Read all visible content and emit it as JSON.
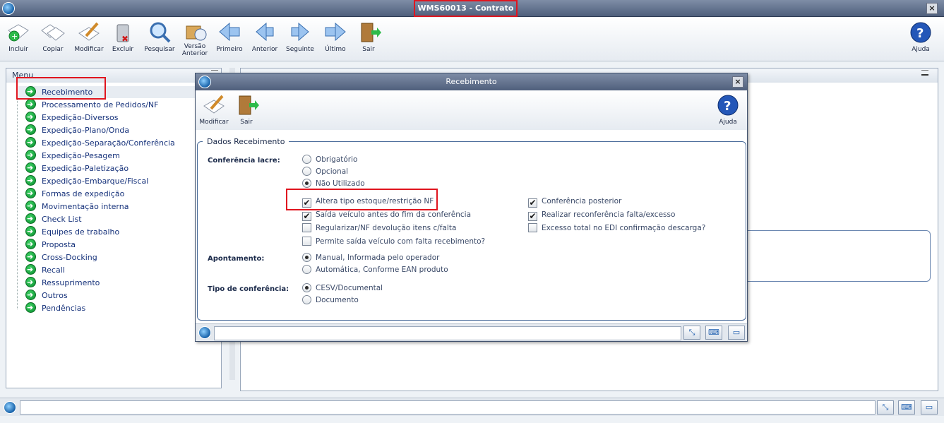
{
  "window": {
    "title": "WMS60013 - Contrato"
  },
  "toolbar": {
    "buttons": [
      {
        "label": "Incluir",
        "icon": "add-doc-icon"
      },
      {
        "label": "Copiar",
        "icon": "copy-icon"
      },
      {
        "label": "Modificar",
        "icon": "edit-icon"
      },
      {
        "label": "Excluir",
        "icon": "trash-icon"
      },
      {
        "label": "Pesquisar",
        "icon": "search-icon"
      },
      {
        "label": "Versão Anterior",
        "icon": "version-icon"
      },
      {
        "label": "Primeiro",
        "icon": "first-icon"
      },
      {
        "label": "Anterior",
        "icon": "prev-icon"
      },
      {
        "label": "Seguinte",
        "icon": "next-icon"
      },
      {
        "label": "Último",
        "icon": "last-icon"
      },
      {
        "label": "Sair",
        "icon": "exit-icon"
      }
    ],
    "help_label": "Ajuda"
  },
  "menu": {
    "title": "Menu",
    "items": [
      "Recebimento",
      "Processamento de Pedidos/NF",
      "Expedição-Diversos",
      "Expedição-Plano/Onda",
      "Expedição-Separação/Conferência",
      "Expedição-Pesagem",
      "Expedição-Paletização",
      "Expedição-Embarque/Fiscal",
      "Formas de expedição",
      "Movimentação interna",
      "Check List",
      "Equipes de trabalho",
      "Proposta",
      "Cross-Docking",
      "Recall",
      "Ressuprimento",
      "Outros",
      "Pendências"
    ],
    "selected": "Recebimento"
  },
  "dialog": {
    "title": "Recebimento",
    "toolbar": {
      "modify_label": "Modificar",
      "exit_label": "Sair",
      "help_label": "Ajuda"
    },
    "section_title": "Dados Recebimento",
    "conferencia_lacre": {
      "label": "Conferência lacre:",
      "options": [
        "Obrigatório",
        "Opcional",
        "Não Utilizado"
      ],
      "selected": "Não Utilizado"
    },
    "checks_left": [
      {
        "label": "Altera tipo estoque/restrição NF",
        "checked": true
      },
      {
        "label": "Saída veículo antes do fim da conferência",
        "checked": true
      },
      {
        "label": "Regularizar/NF devolução itens c/falta",
        "checked": false
      },
      {
        "label": "Permite saída veículo com falta recebimento?",
        "checked": false
      }
    ],
    "checks_right": [
      {
        "label": "Conferência posterior",
        "checked": true
      },
      {
        "label": "Realizar reconferência falta/excesso",
        "checked": true
      },
      {
        "label": "Excesso total no EDI confirmação descarga?",
        "checked": false
      }
    ],
    "apontamento": {
      "label": "Apontamento:",
      "options": [
        "Manual, Informada pelo operador",
        "Automática, Conforme EAN produto"
      ],
      "selected": "Manual, Informada pelo operador"
    },
    "tipo_conferencia": {
      "label": "Tipo de conferência:",
      "options": [
        "CESV/Documental",
        "Documento"
      ],
      "selected": "CESV/Documental"
    },
    "check_mark": "✔"
  }
}
